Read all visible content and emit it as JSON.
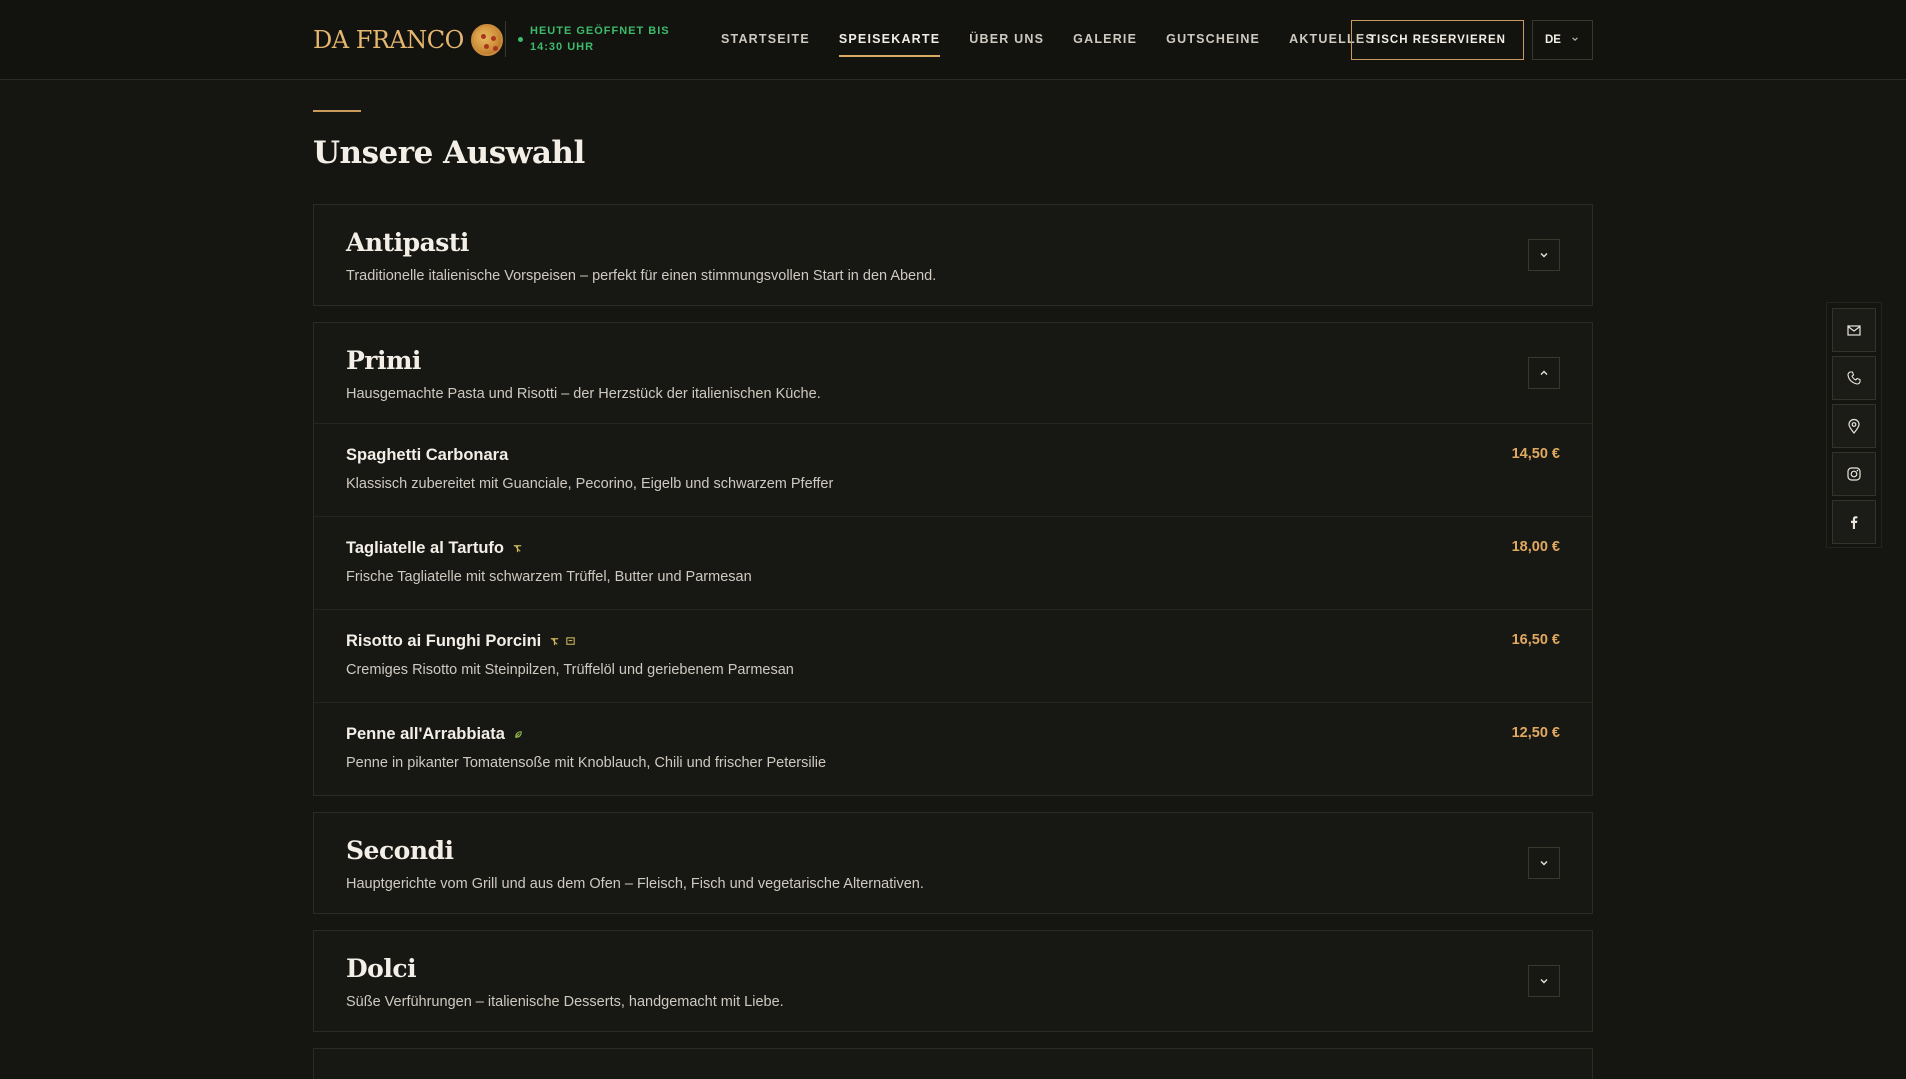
{
  "header": {
    "logo_text": "DA FRANCO",
    "status": "HEUTE GEÖFFNET BIS 14:30 UHR",
    "nav": [
      {
        "label": "STARTSEITE",
        "active": false
      },
      {
        "label": "SPEISEKARTE",
        "active": true
      },
      {
        "label": "ÜBER UNS",
        "active": false
      },
      {
        "label": "GALERIE",
        "active": false
      },
      {
        "label": "GUTSCHEINE",
        "active": false
      },
      {
        "label": "AKTUELLES",
        "active": false
      }
    ],
    "reserve_label": "TISCH RESERVIEREN",
    "language": "DE"
  },
  "main": {
    "title": "Unsere Auswahl",
    "categories": [
      {
        "title": "Antipasti",
        "description": "Traditionelle italienische Vorspeisen – perfekt für einen stimmungsvollen Start in den Abend.",
        "expanded": false
      },
      {
        "title": "Primi",
        "description": "Hausgemachte Pasta und Risotti – der Herzstück der italienischen Küche.",
        "expanded": true,
        "dishes": [
          {
            "name": "Spaghetti Carbonara",
            "description": "Klassisch zubereitet mit Guanciale, Pecorino, Eigelb und schwarzem Pfeffer",
            "price": "14,50 €",
            "tags": []
          },
          {
            "name": "Tagliatelle al Tartufo",
            "description": "Frische Tagliatelle mit schwarzem Trüffel, Butter und Parmesan",
            "price": "18,00 €",
            "tags": [
              "vegetarian-icon"
            ]
          },
          {
            "name": "Risotto ai Funghi Porcini",
            "description": "Cremiges Risotto mit Steinpilzen, Trüffelöl und geriebenem Parmesan",
            "price": "16,50 €",
            "tags": [
              "vegetarian-icon",
              "lactose-icon"
            ]
          },
          {
            "name": "Penne all'Arrabbiata",
            "description": "Penne in pikanter Tomatensoße mit Knoblauch, Chili und frischer Petersilie",
            "price": "12,50 €",
            "tags": [
              "vegan-icon"
            ]
          }
        ]
      },
      {
        "title": "Secondi",
        "description": "Hauptgerichte vom Grill und aus dem Ofen – Fleisch, Fisch und vegetarische Alternativen.",
        "expanded": false
      },
      {
        "title": "Dolci",
        "description": "Süße Verführungen – italienische Desserts, handgemacht mit Liebe.",
        "expanded": false
      }
    ]
  },
  "contact_bar": [
    "mail-icon",
    "phone-icon",
    "location-icon",
    "instagram-icon",
    "facebook-icon"
  ],
  "colors": {
    "accent": "#c99a5c",
    "price": "#e0a95f",
    "status_green": "#3dbb6a",
    "background": "#151512"
  }
}
